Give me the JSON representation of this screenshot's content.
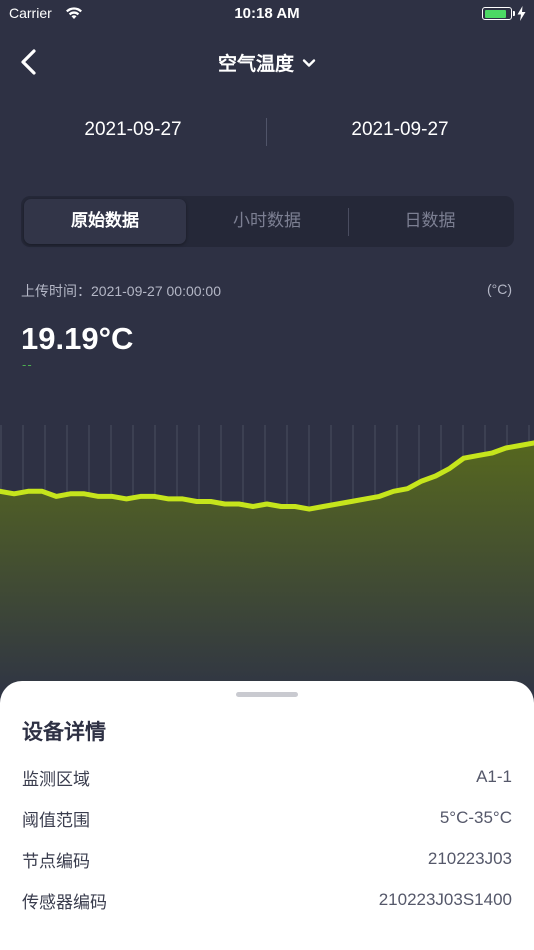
{
  "status_bar": {
    "carrier": "Carrier",
    "time": "10:18 AM",
    "battery_level": 0.9
  },
  "nav": {
    "title": "空气温度"
  },
  "dates": {
    "start": "2021-09-27",
    "end": "2021-09-27"
  },
  "segments": [
    {
      "label": "原始数据",
      "active": true
    },
    {
      "label": "小时数据",
      "active": false
    },
    {
      "label": "日数据",
      "active": false
    }
  ],
  "reading": {
    "upload_time": "上传时间：2021-09-27 00:00:00",
    "unit": "(°C)",
    "value": "19.19°C",
    "delta": "--"
  },
  "chart_data": {
    "type": "area",
    "series": [
      {
        "values": [
          18.2,
          18.1,
          18.2,
          18.2,
          18.0,
          18.1,
          18.1,
          18.0,
          18.0,
          17.9,
          18.0,
          18.0,
          17.9,
          17.9,
          17.8,
          17.8,
          17.7,
          17.7,
          17.6,
          17.7,
          17.6,
          17.6,
          17.5,
          17.6,
          17.7,
          17.8,
          17.9,
          18.0,
          18.2,
          18.3,
          18.6,
          18.8,
          19.1,
          19.5,
          19.6,
          19.7,
          19.9,
          20.0,
          20.1
        ]
      }
    ],
    "ylim": [
      10,
      21
    ],
    "colors": {
      "line": "#c6e51c",
      "fill_top": "#56671f",
      "fill_bottom": "#2f3445",
      "grid": "#4b4e5f"
    }
  },
  "sheet": {
    "title": "设备详情",
    "rows": [
      {
        "label": "监测区域",
        "value": "A1-1"
      },
      {
        "label": "阈值范围",
        "value": "5°C-35°C"
      },
      {
        "label": "节点编码",
        "value": "210223J03"
      },
      {
        "label": "传感器编码",
        "value": "210223J03S1400"
      }
    ]
  }
}
